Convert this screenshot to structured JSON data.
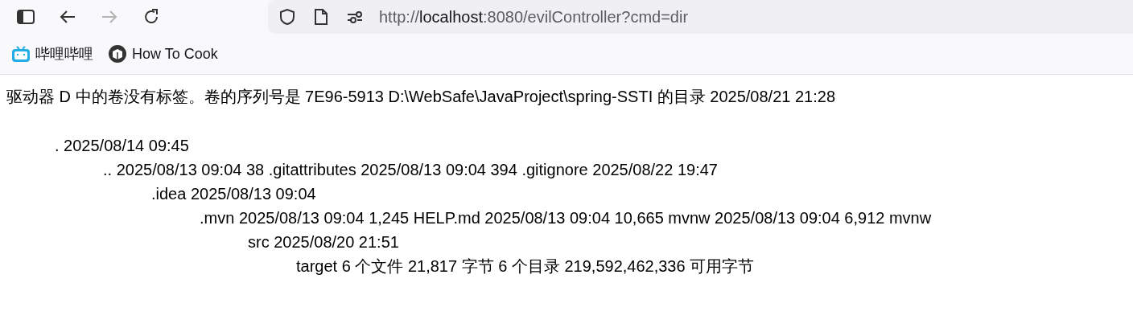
{
  "toolbar": {
    "back_disabled": false,
    "forward_disabled": true,
    "url": {
      "scheme": "http://",
      "host": "localhost",
      "rest": ":8080/evilController?cmd=dir"
    }
  },
  "bookmarks": [
    {
      "label": "哔哩哔哩",
      "kind": "bili"
    },
    {
      "label": "How To Cook",
      "kind": "book"
    }
  ],
  "page": {
    "heading": "驱动器 D 中的卷没有标签。卷的序列号是 7E96-5913 D:\\WebSafe\\JavaProject\\spring-SSTI 的目录 2025/08/21 21:28",
    "entries": [
      {
        "text": ". 2025/08/14 09:45",
        "children": [
          {
            "text": ".. 2025/08/13 09:04 38 .gitattributes 2025/08/13 09:04 394 .gitignore 2025/08/22 19:47",
            "children": [
              {
                "text": ".idea 2025/08/13 09:04",
                "children": [
                  {
                    "text": ".mvn 2025/08/13 09:04 1,245 HELP.md 2025/08/13 09:04 10,665 mvnw 2025/08/13 09:04 6,912 mvnw",
                    "children": [
                      {
                        "text": "src 2025/08/20 21:51",
                        "children": [
                          {
                            "text": "target 6 个文件 21,817 字节 6 个目录 219,592,462,336 可用字节"
                          }
                        ]
                      }
                    ]
                  }
                ]
              }
            ]
          }
        ]
      }
    ]
  }
}
